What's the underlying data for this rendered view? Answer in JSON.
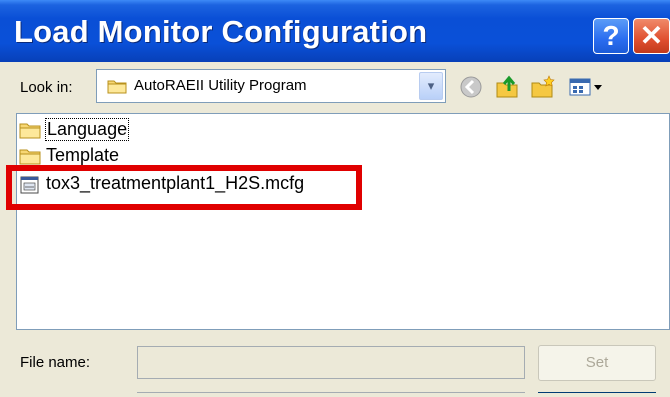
{
  "window": {
    "title": "Load Monitor Configuration"
  },
  "titlebar": {
    "help_label": "?",
    "close_label": "✕"
  },
  "lookin": {
    "label": "Look in:",
    "value": "AutoRAEII Utility Program",
    "dropdown_glyph": "▾"
  },
  "toolbar": {
    "icons": [
      "back-icon",
      "up-folder-icon",
      "new-folder-icon",
      "view-menu-icon"
    ]
  },
  "files": [
    {
      "name": "Language",
      "icon": "folder-icon"
    },
    {
      "name": "Template",
      "icon": "folder-icon"
    },
    {
      "name": "tox3_treatmentplant1_H2S.mcfg",
      "icon": "config-file-icon"
    }
  ],
  "filename": {
    "label": "File name:",
    "value": ""
  },
  "buttons": {
    "set_label": "Set"
  },
  "colors": {
    "title_blue": "#0a50d8",
    "highlight_red": "#e00000",
    "dialog_bg": "#ece9d8"
  }
}
